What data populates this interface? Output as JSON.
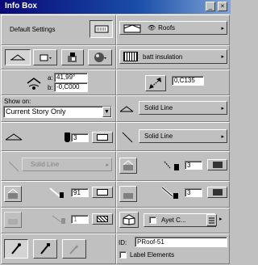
{
  "window": {
    "title": "Info Box",
    "minimize_glyph": "_",
    "close_glyph": "×"
  },
  "left": {
    "default_settings_label": "Default Settings",
    "angle_label_a": "a:",
    "angle_value": "41,99°",
    "angle_label_b": "b:",
    "offset_value": "-0,C000",
    "show_on_label": "Show on:",
    "show_on_value": "Current Story Only",
    "pen_value_1": "3",
    "disabled_line_type": "Solid Line",
    "pen_value_2": "91",
    "pen_value_3": "1"
  },
  "right": {
    "roofs_label": "Roofs",
    "material_label": "batt insulation",
    "thickness_value": "0,C135",
    "line_type_1": "Solid Line",
    "line_type_2": "Solid Line",
    "pen_value_1": "3",
    "pen_value_2": "3",
    "layer_label": "Ayet C...",
    "id_label": "ID:",
    "id_value": "PRoof-51",
    "label_elements": "Label Elements"
  },
  "icons": {
    "eye": "eye-icon",
    "pen": "pen-icon"
  }
}
